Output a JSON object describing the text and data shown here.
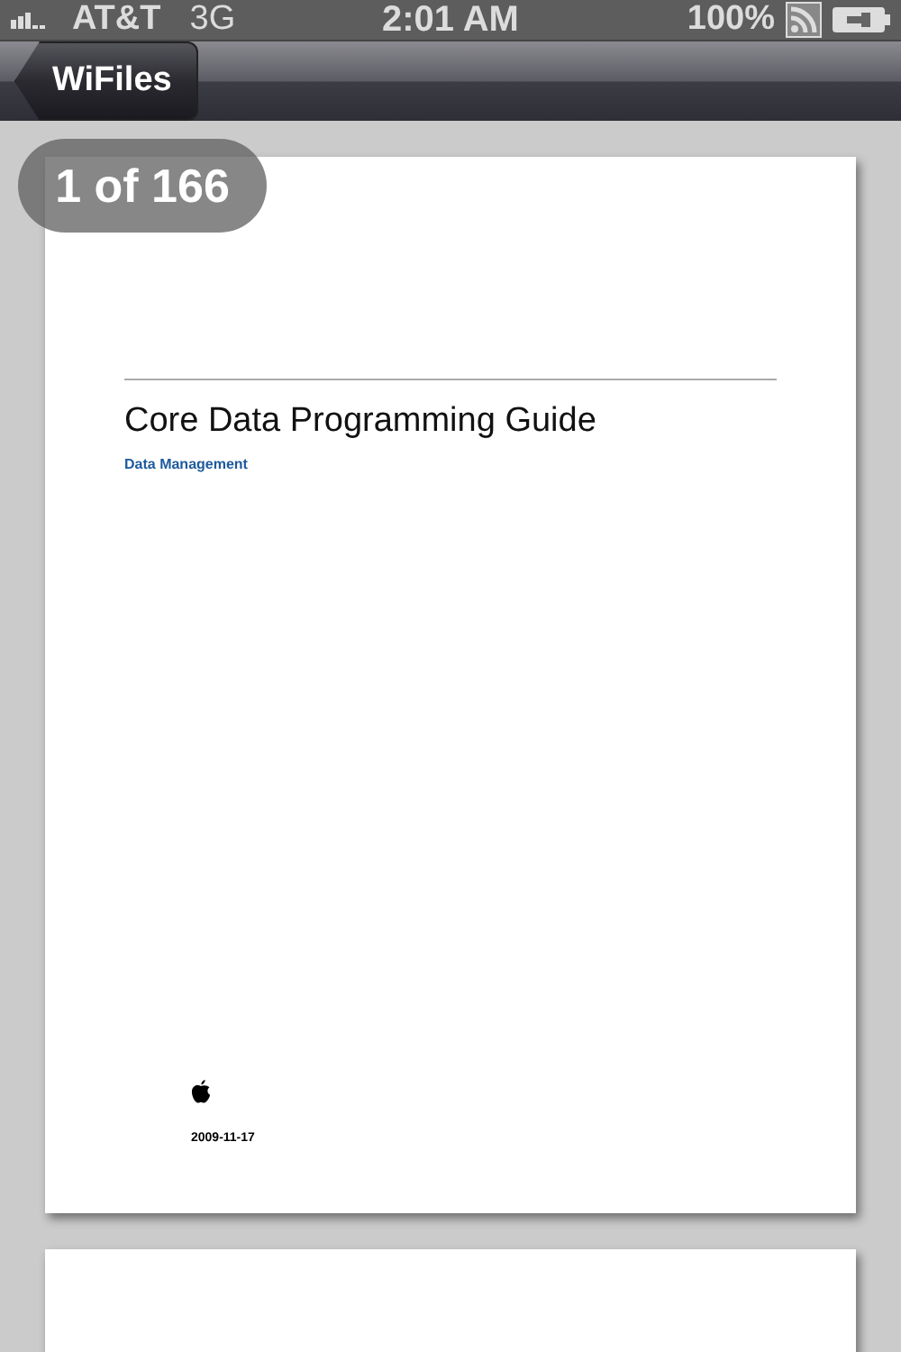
{
  "status_bar": {
    "carrier": "AT&T",
    "network": "3G",
    "time": "2:01 AM",
    "battery": "100%"
  },
  "nav_bar": {
    "back_button": "WiFiles"
  },
  "viewer": {
    "page_counter": "1 of 166",
    "page": {
      "title": "Core Data Programming Guide",
      "subtitle": "Data Management",
      "date": "2009-11-17"
    }
  }
}
